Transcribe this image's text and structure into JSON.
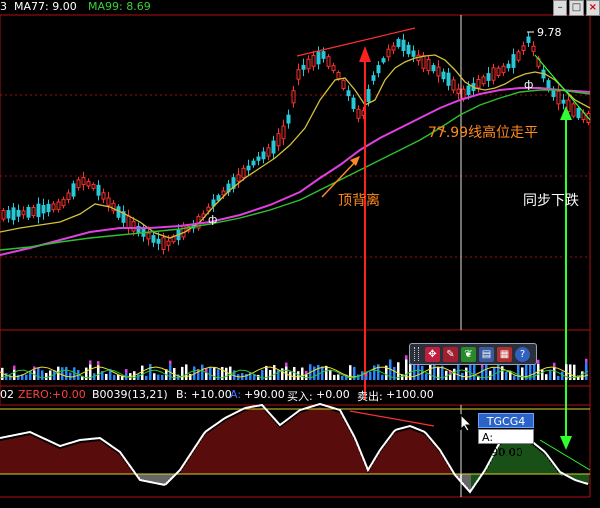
{
  "header": {
    "ma_prefix": "3",
    "ma77": "MA77: 9.00",
    "ma99": "MA99: 8.69",
    "colors": {
      "ma77": "#ffffff",
      "ma99": "#3ad13a"
    }
  },
  "price_chart": {
    "peak_label": "9.78",
    "annotations": {
      "top_divergence": "顶背离",
      "ma_flat": "77.99线高位走平",
      "sync_fall": "同步下跌"
    },
    "colors": {
      "annotation": "#ff8a1e",
      "red_arrow": "#ff2a2a",
      "green_arrow": "#30ff30"
    }
  },
  "toolbar": {
    "icons": [
      "pointer-icon",
      "draw-icon",
      "leaf-icon",
      "chart-icon",
      "calendar-icon",
      "help-icon"
    ]
  },
  "indicator_bar": {
    "prefix": "02",
    "zero": "ZERO:",
    "zero_val": "+0.00",
    "b_formula": "B0039(13,21)",
    "b_label": "B:",
    "b_val": "+10.00",
    "a_label": "A:",
    "a_val": "+90.00",
    "buy_label": "买入:",
    "buy_val": "+0.00",
    "sell_label": "卖出:",
    "sell_val": "+100.00"
  },
  "tooltip": {
    "name": "TGCG4",
    "value": "A: +90.00"
  }
}
